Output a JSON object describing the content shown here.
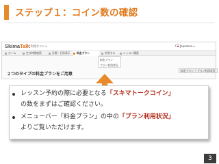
{
  "slide": {
    "title": "ステップ１：コイン数の確認",
    "page_number": "3",
    "accent_color": "#e8892b",
    "emphasis_color": "#b22a1a"
  },
  "screenshot": {
    "logo_main": "Skima",
    "logo_accent": "Talk",
    "guide_link": "ご利用ガイド ▾",
    "language": "Japanese ▾",
    "nav": [
      {
        "label": "ホーム"
      },
      {
        "label": "空き時間検索"
      },
      {
        "label": "月間・日別表示"
      },
      {
        "label": "料金プラン"
      },
      {
        "label": "学習する"
      },
      {
        "label": "レッスン履歴"
      }
    ],
    "dropdown": [
      "料金プラン",
      "プラン利用状況"
    ],
    "sub_heading": "２つのタイプの料金プランをご用意",
    "buttons": [
      "料金プラン",
      "プラン利用状況"
    ]
  },
  "bullets": [
    {
      "before": "レッスン予約の際に必要となる",
      "emph": "「スキマトークコイン」",
      "after": "の数をまずはご確認ください。"
    },
    {
      "before": "メニューバー「料金プラン」の中の",
      "emph": "「プラン利用状況」",
      "after": "よりご覧いただけます。"
    }
  ]
}
